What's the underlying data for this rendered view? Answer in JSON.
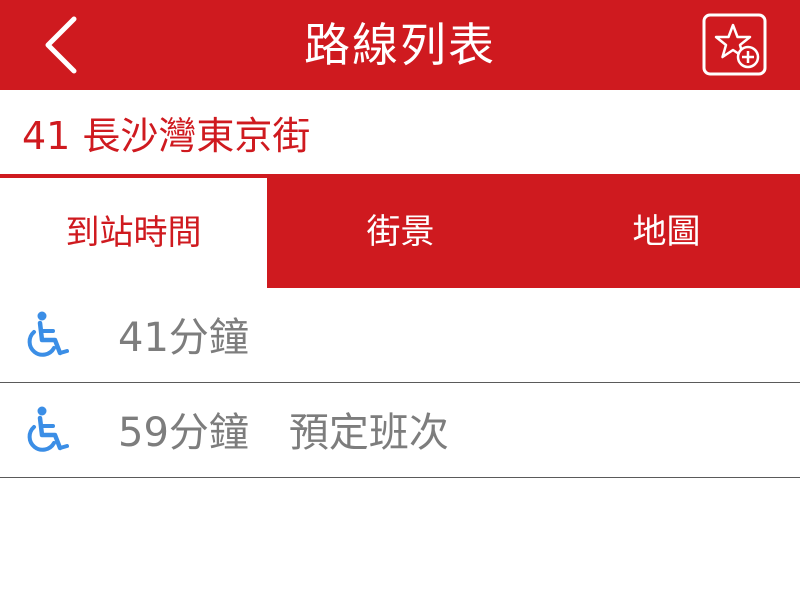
{
  "header": {
    "title": "路線列表",
    "back_icon": "chevron-left-icon",
    "favorite_icon": "star-add-icon"
  },
  "route": {
    "label": "41 長沙灣東京街"
  },
  "tabs": [
    {
      "label": "到站時間",
      "active": true
    },
    {
      "label": "街景",
      "active": false
    },
    {
      "label": "地圖",
      "active": false
    }
  ],
  "arrivals": [
    {
      "text": "41分鐘",
      "icon": "wheelchair-icon"
    },
    {
      "text": "59分鐘　預定班次",
      "icon": "wheelchair-icon"
    }
  ],
  "colors": {
    "accent": "#cf1a1f",
    "wheelchair": "#3b8ee6",
    "row_text": "#7d7d7d"
  }
}
